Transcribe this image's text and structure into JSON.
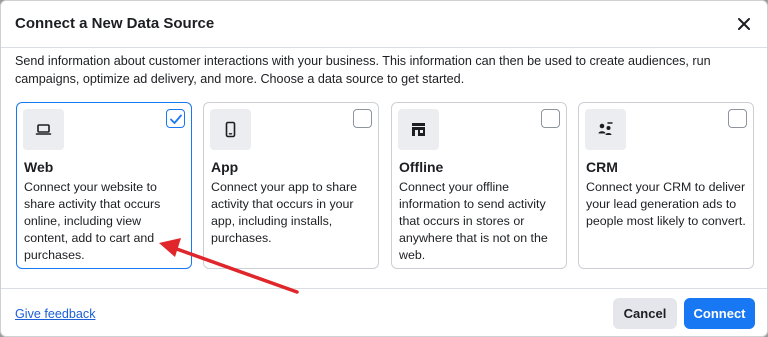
{
  "dialog": {
    "title": "Connect a New Data Source",
    "close_icon": "close-icon",
    "description": "Send information about customer interactions with your business. This information can then be used to create audiences, run campaigns, optimize ad delivery, and more. Choose a data source to get started."
  },
  "cards": [
    {
      "title": "Web",
      "description": "Connect your website to share activity that occurs online, including view content, add to cart and purchases.",
      "icon": "laptop-icon",
      "selected": true
    },
    {
      "title": "App",
      "description": "Connect your app to share activity that occurs in your app, including installs, purchases.",
      "icon": "mobile-phone-icon",
      "selected": false
    },
    {
      "title": "Offline",
      "description": "Connect your offline information to send activity that occurs in stores or anywhere that is not on the web.",
      "icon": "store-icon",
      "selected": false
    },
    {
      "title": "CRM",
      "description": "Connect your CRM to deliver your lead generation ads to people most likely to convert.",
      "icon": "people-icon",
      "selected": false
    }
  ],
  "footer": {
    "feedback_label": "Give feedback",
    "cancel_label": "Cancel",
    "connect_label": "Connect"
  },
  "colors": {
    "accent": "#1877f2",
    "annotation_arrow": "#e0262b"
  }
}
